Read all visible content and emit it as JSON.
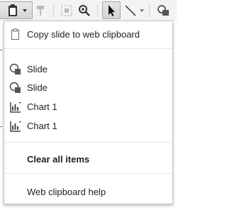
{
  "toolbar": {
    "buttons": [
      {
        "icon": "clipboard-icon",
        "state": "open"
      },
      {
        "icon": "paint-format-icon",
        "state": "disabled"
      },
      {
        "icon": "select-region-icon",
        "state": "disabled"
      },
      {
        "icon": "zoom-icon",
        "state": "enabled"
      },
      {
        "icon": "select-cursor-icon",
        "state": "active"
      },
      {
        "icon": "line-icon",
        "state": "enabled"
      },
      {
        "icon": "shape-icon",
        "state": "enabled"
      }
    ]
  },
  "menu": {
    "copy_label": "Copy slide to web clipboard",
    "items": [
      {
        "label": "Slide",
        "icon": "slide-icon"
      },
      {
        "label": "Slide",
        "icon": "slide-icon"
      },
      {
        "label": "Chart 1",
        "icon": "chart-icon"
      },
      {
        "label": "Chart 1",
        "icon": "chart-icon"
      }
    ],
    "clear_label": "Clear all items",
    "help_label": "Web clipboard help"
  },
  "colors": {
    "menu_border": "#c3c3c3",
    "separator": "#e5e5e5",
    "text": "#222222",
    "accent": "#4a7fd1"
  }
}
